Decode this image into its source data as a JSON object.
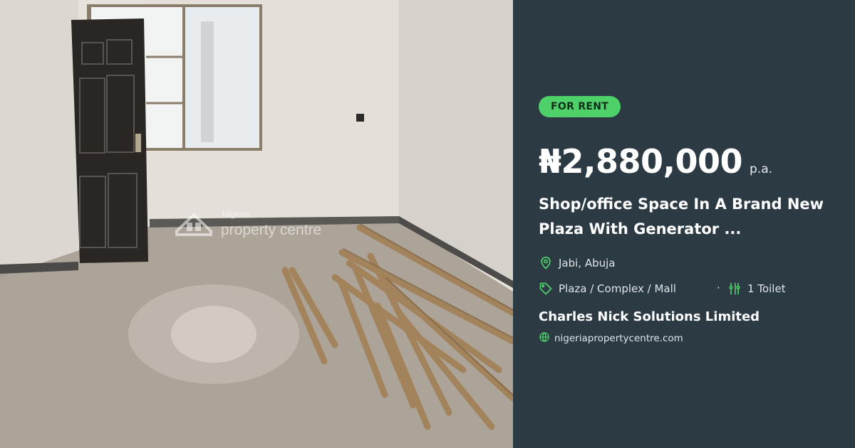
{
  "photo": {
    "watermark_top": "Nigeria",
    "watermark_main": "property centre"
  },
  "listing": {
    "badge": "FOR RENT",
    "price": "₦2,880,000",
    "period": "p.a.",
    "title_line1": "Shop/office Space In A Brand New",
    "title_line2": "Plaza With Generator ...",
    "location": "Jabi, Abuja",
    "property_type": "Plaza / Complex / Mall",
    "separator": "·",
    "toilets": "1 Toilet",
    "agent": "Charles Nick Solutions Limited",
    "website": "nigeriapropertycentre.com"
  },
  "colors": {
    "panel_bg": "#2c3a44",
    "badge_bg": "#4fd169",
    "icon_accent": "#4fd169"
  },
  "icons": [
    "location-pin-icon",
    "tag-icon",
    "toilet-icon",
    "globe-icon"
  ]
}
